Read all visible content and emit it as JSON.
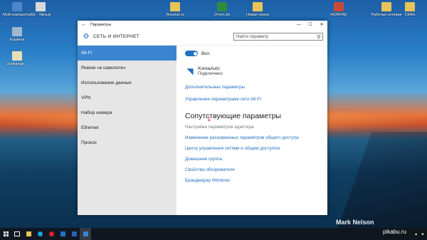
{
  "desktop": {
    "icons": [
      {
        "label": "Мой компьютер",
        "color": "#4a86c8"
      },
      {
        "label": "SE - Ярлык",
        "color": "#d8d8d8"
      },
      {
        "label": "Корзина",
        "color": "#9fb8d0"
      },
      {
        "label": "2polupogr...",
        "color": "#e8e0b8"
      },
      {
        "label": "Rosstat.ru",
        "color": "#e7c35a"
      },
      {
        "label": "Отчет.xls",
        "color": "#2e8b3e"
      },
      {
        "label": "Новая папка",
        "color": "#e7c35a"
      },
      {
        "label": "HOMYAK",
        "color": "#c84b3a"
      },
      {
        "label": "Рабочая сетевая",
        "color": "#e7c35a"
      },
      {
        "label": "СКАН",
        "color": "#e7c35a"
      }
    ],
    "watermark": "Mark Nelson",
    "site_watermark": "pikabu.ru"
  },
  "window": {
    "title": "Параметры",
    "header_title": "СЕТЬ И ИНТЕРНЕТ",
    "search_placeholder": "Найти параметр",
    "sidebar": [
      {
        "label": "Wi-Fi",
        "active": true
      },
      {
        "label": "Режим «в самолете»",
        "active": false
      },
      {
        "label": "Использование данных",
        "active": false
      },
      {
        "label": "VPN",
        "active": false
      },
      {
        "label": "Набор номера",
        "active": false
      },
      {
        "label": "Ethernet",
        "active": false
      },
      {
        "label": "Прокси",
        "active": false
      }
    ],
    "wifi_toggle_label": "Вкл.",
    "network_name": "KoreaAuto",
    "network_status": "Подключено",
    "links": {
      "advanced": "Дополнительные параметры",
      "manage": "Управление параметрами сети Wi-Fi"
    },
    "related_title": "Сопутствующие параметры",
    "related": [
      {
        "label": "Настройка параметров адаптера",
        "disabled": true
      },
      {
        "label": "Изменение расширенных параметров общего доступа",
        "disabled": false
      },
      {
        "label": "Центр управления сетями и общим доступом",
        "disabled": false
      },
      {
        "label": "Домашняя группа",
        "disabled": false
      },
      {
        "label": "Свойства обозревателя",
        "disabled": false
      },
      {
        "label": "Брандмауэр Windows",
        "disabled": false
      }
    ]
  },
  "colors": {
    "accent": "#1f6fbf",
    "sidebar_active": "#3a84d0"
  }
}
